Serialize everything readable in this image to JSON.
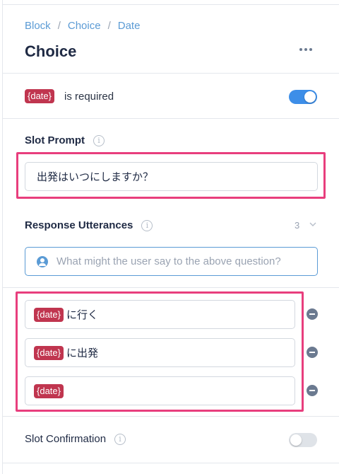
{
  "breadcrumb": [
    "Block",
    "Choice",
    "Date"
  ],
  "page_title": "Choice",
  "required": {
    "tag": "{date}",
    "text": "is required",
    "enabled": true
  },
  "slot_prompt": {
    "label": "Slot Prompt",
    "value": "出発はいつにしますか？"
  },
  "response_utterances": {
    "label": "Response Utterances",
    "count": "3",
    "placeholder": "What might the user say to the above question?",
    "items": [
      {
        "tag": "{date}",
        "text": "に行く"
      },
      {
        "tag": "{date}",
        "text": "に出発"
      },
      {
        "tag": "{date}",
        "text": ""
      }
    ]
  },
  "slot_confirmation": {
    "label": "Slot Confirmation",
    "enabled": false
  },
  "colors": {
    "accent": "#3d8ee8",
    "tag": "#c0354f",
    "highlight": "#e83e7d",
    "link": "#5b9bd5"
  },
  "icons": {
    "info": "info-icon",
    "more": "more-options-icon",
    "user": "user-icon",
    "remove": "remove-icon",
    "chevron": "chevron-down-icon"
  }
}
